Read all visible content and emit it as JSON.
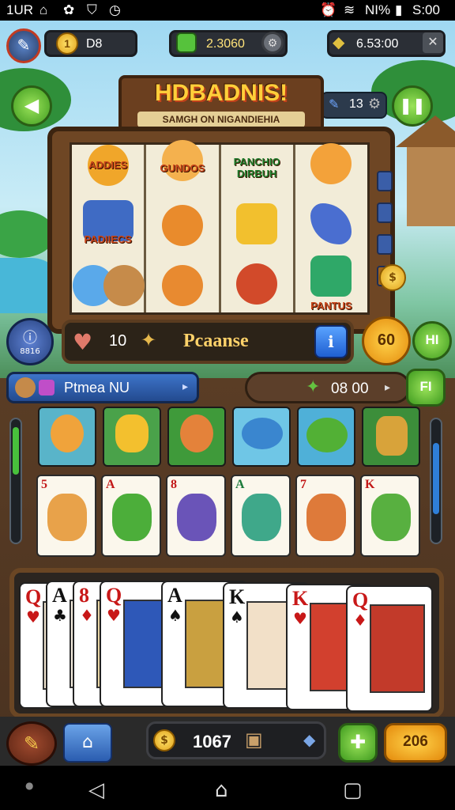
{
  "status_bar": {
    "left_text": "1UR",
    "time": "S:00",
    "battery_text": "NI%"
  },
  "top_bar": {
    "coins_value": "D8",
    "gems_value": "2.3060",
    "cash_value": "6.53:00"
  },
  "title": {
    "main": "HDBADNIS!",
    "subtitle": "SAMGH ON NIGANDIEHIA"
  },
  "reels": [
    {
      "labels": [
        "ADDIES",
        "",
        ""
      ]
    },
    {
      "labels": [
        "GUNDOS",
        "",
        ""
      ]
    },
    {
      "labels": [
        "PANCHIO DIRBUH",
        "",
        ""
      ]
    },
    {
      "labels": [
        "",
        "",
        "PANTUS"
      ]
    }
  ],
  "reel_extra_label": "PADIIECS",
  "side_counter": "13",
  "controls": {
    "bet_value": "10",
    "label": "Pcaanse",
    "left_round_label": "8816",
    "orange_button": "60",
    "green_button": "HI"
  },
  "info_row": {
    "blue_bar_text": "Ptmea NU",
    "wood_bar_value": "08 00",
    "green_small_button": "FI"
  },
  "tile_ranks": [
    "5",
    "A",
    "8",
    "A",
    "7",
    "K"
  ],
  "cards": [
    {
      "rank": "Q",
      "suit": "♥",
      "color": "#c81818"
    },
    {
      "rank": "A",
      "suit": "♣",
      "color": "#111111"
    },
    {
      "rank": "8",
      "suit": "♦",
      "color": "#c81818"
    },
    {
      "rank": "Q",
      "suit": "♥",
      "color": "#c81818"
    },
    {
      "rank": "A",
      "suit": "♠",
      "color": "#111111"
    },
    {
      "rank": "K",
      "suit": "♠",
      "color": "#111111"
    },
    {
      "rank": "K",
      "suit": "♥",
      "color": "#c81818"
    },
    {
      "rank": "Q",
      "suit": "♦",
      "color": "#c81818"
    }
  ],
  "bottom_bar": {
    "coin_total": "1067",
    "orange_button": "206"
  },
  "colors": {
    "wood": "#6e4624",
    "accent_green": "#3f9b1f",
    "accent_orange": "#e48a0c",
    "accent_blue": "#1f5fd1"
  }
}
